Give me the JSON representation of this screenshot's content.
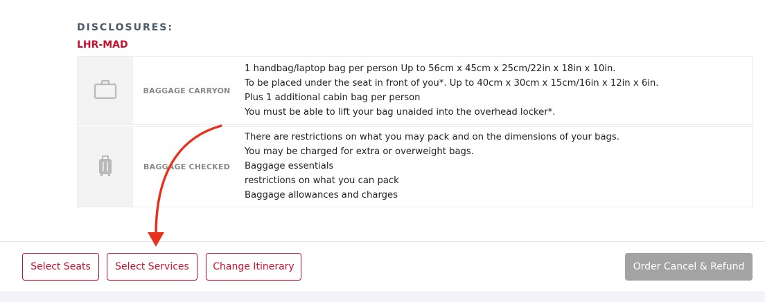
{
  "disclosures": {
    "title": "DISCLOSURES:",
    "route": "LHR-MAD"
  },
  "baggage": [
    {
      "icon": "briefcase-icon",
      "type": "BAGGAGE CARRYON",
      "lines": [
        "1 handbag/laptop bag per person Up to 56cm x 45cm x 25cm/22in x 18in x 10in.",
        "To be placed under the seat in front of you*. Up to 40cm x 30cm x 15cm/16in x 12in x 6in.",
        "Plus 1 additional cabin bag per person",
        "You must be able to lift your bag unaided into the overhead locker*."
      ]
    },
    {
      "icon": "suitcase-icon",
      "type": "BAGGAGE CHECKED",
      "lines": [
        "There are restrictions on what you may pack and on the dimensions of your bags.",
        "You may be charged for extra or overweight bags.",
        "Baggage essentials",
        "restrictions on what you can pack",
        "Baggage allowances and charges"
      ]
    }
  ],
  "actions": {
    "select_seats": "Select Seats",
    "select_services": "Select Services",
    "change_itinerary": "Change Itinerary",
    "order_cancel_refund": "Order Cancel & Refund"
  },
  "colors": {
    "accent": "#c8102e",
    "heading": "#4a5a6a",
    "disabled_button": "#a3a3a3",
    "annotation_arrow": "#e8321e"
  }
}
